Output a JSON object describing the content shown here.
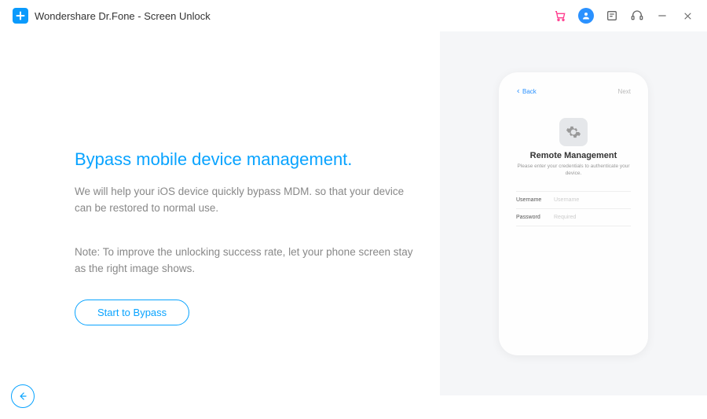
{
  "titlebar": {
    "appTitle": "Wondershare Dr.Fone - Screen Unlock"
  },
  "page": {
    "heading": "Bypass mobile device management.",
    "description": "We will help your iOS device quickly bypass MDM. so that your device can be restored to normal use.",
    "note": "Note: To improve the unlocking success rate, let your phone screen stay as the right image shows.",
    "startButton": "Start to Bypass"
  },
  "phone": {
    "backLabel": "Back",
    "nextLabel": "Next",
    "screenTitle": "Remote Management",
    "screenSub": "Please enter your credentials to authenticate your device.",
    "usernameLabel": "Username",
    "usernamePlaceholder": "Username",
    "passwordLabel": "Password",
    "passwordPlaceholder": "Required"
  }
}
